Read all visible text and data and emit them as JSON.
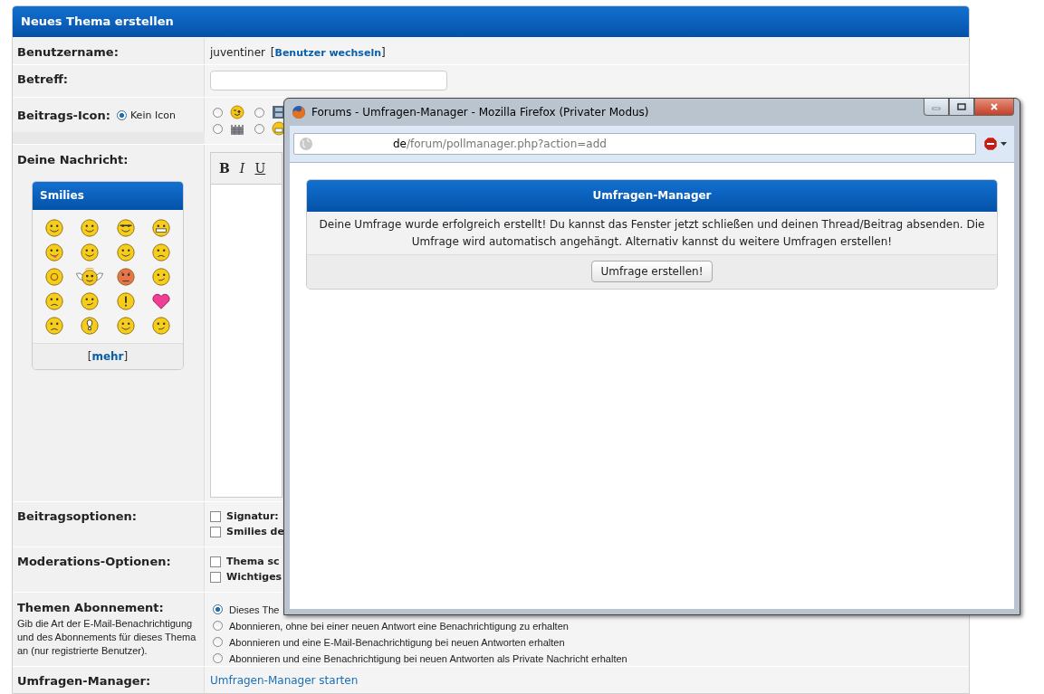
{
  "form": {
    "title": "Neues Thema erstellen"
  },
  "username": {
    "label": "Benutzername:",
    "value": "juventiner",
    "link_before": "[",
    "link": "Benutzer wechseln",
    "link_after": "]"
  },
  "subject": {
    "label": "Betreff:"
  },
  "post_icon": {
    "label": "Beitrags-Icon:",
    "none_label": "Kein Icon",
    "none_selected": true,
    "options": [
      {
        "kind": "wink",
        "selected": false
      },
      {
        "kind": "film",
        "selected": false
      },
      {
        "kind": "castle",
        "selected": false
      },
      {
        "kind": "grin",
        "selected": false
      }
    ]
  },
  "message": {
    "label": "Deine Nachricht:",
    "toolbar": [
      "B",
      "I",
      "U"
    ],
    "smilies": {
      "title": "Smilies",
      "more_before": "[",
      "more": "mehr",
      "more_after": "]"
    }
  },
  "post_options": {
    "label": "Beitragsoptionen:",
    "options": [
      {
        "label": "Signatur:",
        "checked": false
      },
      {
        "label": "Smilies de",
        "checked": false
      }
    ]
  },
  "moderation": {
    "label": "Moderations-Optionen:",
    "options": [
      {
        "label": "Thema sc",
        "checked": false
      },
      {
        "label": "Wichtiges",
        "checked": false
      }
    ]
  },
  "subscription": {
    "label": "Themen Abonnement:",
    "description": "Gib die Art der E-Mail-Benachrichtigung und des Abonnements für dieses Thema an (nur registrierte Benutzer).",
    "options": [
      {
        "label": "Dieses The",
        "selected": true
      },
      {
        "label": "Abonnieren, ohne bei einer neuen Antwort eine Benachrichtigung zu erhalten",
        "selected": false
      },
      {
        "label": "Abonnieren und eine E-Mail-Benachrichtigung bei neuen Antworten erhalten",
        "selected": false
      },
      {
        "label": "Abonnieren und eine Benachrichtigung bei neuen Antworten als Private Nachricht erhalten",
        "selected": false
      }
    ]
  },
  "poll": {
    "label": "Umfragen-Manager:",
    "link": "Umfragen-Manager starten"
  },
  "popup": {
    "title": "Forums - Umfragen-Manager - Mozilla Firefox (Privater Modus)",
    "url_domain": "de",
    "url_path": "/forum/pollmanager.php?action=add",
    "panel": {
      "title": "Umfragen-Manager",
      "message": "Deine Umfrage wurde erfolgreich erstellt! Du kannst das Fenster jetzt schließen und deinen Thread/Beitrag absenden. Die Umfrage wird automatisch angehängt. Alternativ kannst du weitere Umfragen erstellen!",
      "button": "Umfrage erstellen!"
    }
  }
}
